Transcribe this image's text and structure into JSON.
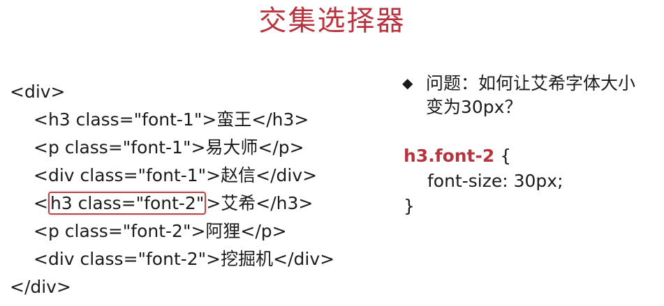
{
  "title": "交集选择器",
  "colors": {
    "title": "#b7333e",
    "selector": "#b7333e",
    "highlight_border": "#b24a4a",
    "text": "#1a1a1a"
  },
  "code": {
    "open": "<div>",
    "l1_open": "<h3 class=\"font-1\">",
    "l1_text": "蛮王",
    "l1_close": "</h3>",
    "l2_open": "<p class=\"font-1\">",
    "l2_text": "易大师",
    "l2_close": "</p>",
    "l3_open": "<div class=\"font-1\">",
    "l3_text": "赵信",
    "l3_close": "</div>",
    "l4_lt": "<",
    "l4_highlight": "h3 class=\"font-2\"",
    "l4_gt": ">",
    "l4_text": "艾希",
    "l4_close": "</h3>",
    "l5_open": "<p class=\"font-2\">",
    "l5_text": "阿狸",
    "l5_close": "</p>",
    "l6_open": "<div class=\"font-2\">",
    "l6_text": "挖掘机",
    "l6_close": "</div>",
    "close": "</div>"
  },
  "question": {
    "bullet": "◆",
    "line1": "问题：如何让艾希字体大小",
    "line2": "变为30px？"
  },
  "css": {
    "selector": "h3.font-2",
    "open_brace": " {",
    "declaration": "font-size: 30px;",
    "close_brace": "}"
  }
}
